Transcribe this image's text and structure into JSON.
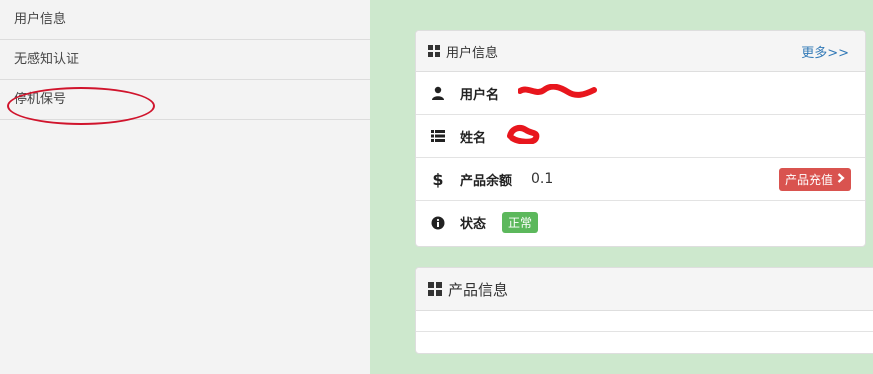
{
  "sidebar": {
    "items": [
      {
        "label": "用户信息"
      },
      {
        "label": "无感知认证"
      },
      {
        "label": "停机保号"
      }
    ]
  },
  "user_panel": {
    "title": "用户信息",
    "more_label": "更多>>",
    "rows": {
      "username": {
        "label": "用户名",
        "icon": "user-icon"
      },
      "name": {
        "label": "姓名",
        "icon": "list-icon"
      },
      "balance": {
        "label": "产品余额",
        "value": "0.1",
        "icon": "dollar-icon",
        "button_label": "产品充值"
      },
      "status": {
        "label": "状态",
        "badge": "正常",
        "icon": "info-icon"
      }
    }
  },
  "product_panel": {
    "title": "产品信息"
  },
  "colors": {
    "page_bg": "#cde8cd",
    "sidebar_bg": "#f3f3f3",
    "link": "#337ab7",
    "danger": "#d9534f",
    "success": "#5cb85c",
    "annotation": "#d0142c"
  }
}
